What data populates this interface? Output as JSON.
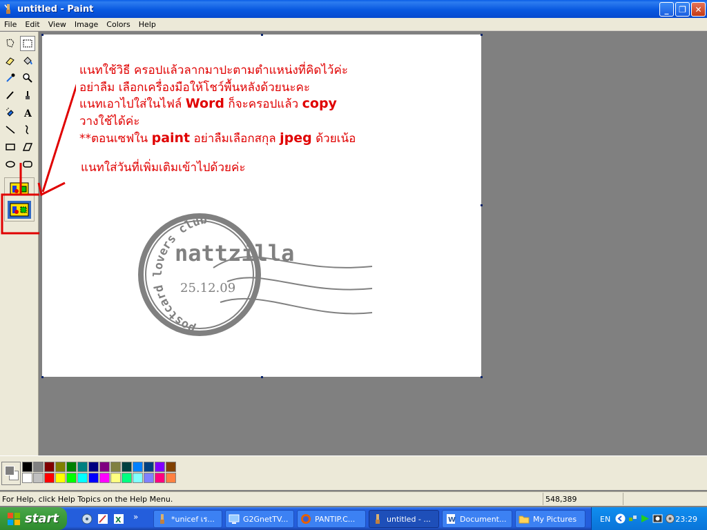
{
  "window": {
    "title": "untitled - Paint",
    "minimize_glyph": "_",
    "maximize_glyph": "❐",
    "close_glyph": "✕"
  },
  "menu": [
    "File",
    "Edit",
    "View",
    "Image",
    "Colors",
    "Help"
  ],
  "canvas_text": {
    "line1": "แนทใช้วิธี ครอปแล้วลากมาปะตามตำแหน่งที่คิดไว้ค่ะ",
    "line2": "อย่าลืม เลือกเครื่องมือให้โชว์พื้นหลังด้วยนะคะ",
    "line3_pre": "แนทเอาไปใส่ในไฟล์ ",
    "line3_word": "Word",
    "line3_mid": " ก็จะครอปแล้ว ",
    "line3_copy": "copy",
    "line4": "วางใช้ได้ค่ะ",
    "line5_pre": "**ตอนเซฟใน ",
    "line5_paint": "paint",
    "line5_mid": " อย่าลืมเลือกสกุล ",
    "line5_jpeg": "jpeg",
    "line5_post": " ด้วยเน้อ",
    "line6": "แนทใส่วันที่เพิ่มเติมเข้าไปด้วยค่ะ"
  },
  "stamp": {
    "name": "nattzilla",
    "date": "25.12.09",
    "ring_text": "postcard lovers club"
  },
  "colors": {
    "annotation_red": "#e00000",
    "stamp_gray": "#808080",
    "palette": [
      "#000000",
      "#808080",
      "#800000",
      "#808000",
      "#008000",
      "#008080",
      "#000080",
      "#800080",
      "#808040",
      "#004040",
      "#0080ff",
      "#004080",
      "#8000ff",
      "#804000",
      "#ffffff",
      "#c0c0c0",
      "#ff0000",
      "#ffff00",
      "#00ff00",
      "#00ffff",
      "#0000ff",
      "#ff00ff",
      "#ffff80",
      "#00ff80",
      "#80ffff",
      "#8080ff",
      "#ff0080",
      "#ff8040"
    ]
  },
  "status": {
    "help": "For Help, click Help Topics on the Help Menu.",
    "coords": "548,389"
  },
  "taskbar": {
    "start": "start",
    "tasks": [
      "*unicef เร...",
      "G2GnetTV...",
      "PANTIP.C...",
      "untitled - ...",
      "Document...",
      "My Pictures"
    ],
    "language": "EN",
    "clock": "23:29"
  }
}
